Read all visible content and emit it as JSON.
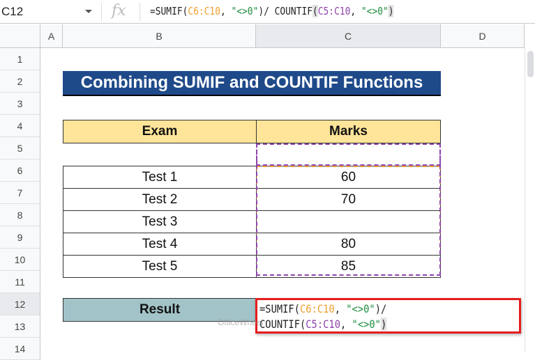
{
  "formula_bar": {
    "name_box": "C12",
    "fx_icon": "function-icon",
    "formula": {
      "p1": "=SUMIF(",
      "r1": "C6:C10",
      "p2": ", ",
      "s1": "\"<>0\"",
      "p3": ")/ COUNTIF",
      "p4": "(",
      "r2": "C5:C10",
      "p5": ", ",
      "s2": "\"<>0\"",
      "p6": ")"
    }
  },
  "columns": [
    "A",
    "B",
    "C",
    "D"
  ],
  "rows": [
    "1",
    "2",
    "3",
    "4",
    "5",
    "6",
    "7",
    "8",
    "9",
    "10",
    "11",
    "12",
    "13",
    "14"
  ],
  "sheet": {
    "title": "Combining SUMIF and COUNTIF Functions",
    "headers": {
      "exam": "Exam",
      "marks": "Marks"
    },
    "data": [
      {
        "exam": "",
        "marks": ""
      },
      {
        "exam": "Test 1",
        "marks": "60"
      },
      {
        "exam": "Test 2",
        "marks": "70"
      },
      {
        "exam": "Test 3",
        "marks": ""
      },
      {
        "exam": "Test 4",
        "marks": "80"
      },
      {
        "exam": "Test 5",
        "marks": "85"
      }
    ],
    "result_label": "Result",
    "edit": {
      "line1a": "=SUMIF(",
      "line1b": "C6:C10",
      "line1c": ", ",
      "line1d": "\"<>0\"",
      "line1e": ")/",
      "line2a": "COUNTIF(",
      "line2b": "C5:C10",
      "line2c": ", ",
      "line2d": "\"<>0\"",
      "line2e": ")"
    }
  },
  "watermark": "OfficeWheel",
  "colors": {
    "title_bg": "#1f4a8a",
    "header_bg": "#ffe599",
    "result_bg": "#a2c4c9",
    "edit_border": "#e51c1c",
    "range1": "#f0a030",
    "range2": "#8e44ad"
  }
}
